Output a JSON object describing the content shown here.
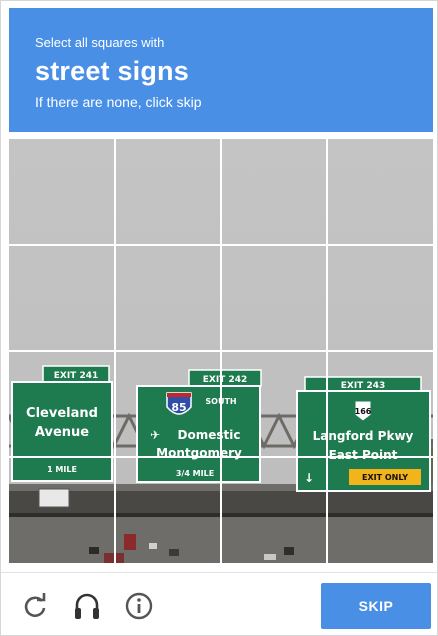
{
  "prompt": {
    "instruction": "Select all squares with",
    "target": "street signs",
    "hint": "If there are none, click skip"
  },
  "image_signs": {
    "sign1_exit": "EXIT 241",
    "sign1_line1": "Cleveland",
    "sign1_line2": "Avenue",
    "sign1_distance": "1 MILE",
    "sign2_exit": "EXIT 242",
    "sign2_shield": "85",
    "sign2_direction": "SOUTH",
    "sign2_line1": "Domestic",
    "sign2_line2": "Montgomery",
    "sign2_distance": "3/4 MILE",
    "sign3_exit": "EXIT 243",
    "sign3_shield": "166",
    "sign3_line1": "Langford Pkwy",
    "sign3_line2": "East Point",
    "sign3_only": "EXIT ONLY"
  },
  "footer": {
    "reload_icon": "reload-icon",
    "audio_icon": "headphones-icon",
    "info_icon": "info-icon",
    "skip_label": "SKIP"
  },
  "colors": {
    "header_bg": "#4a8fe6",
    "skip_bg": "#4a8fe6",
    "sign_green": "#1e7a4f"
  }
}
